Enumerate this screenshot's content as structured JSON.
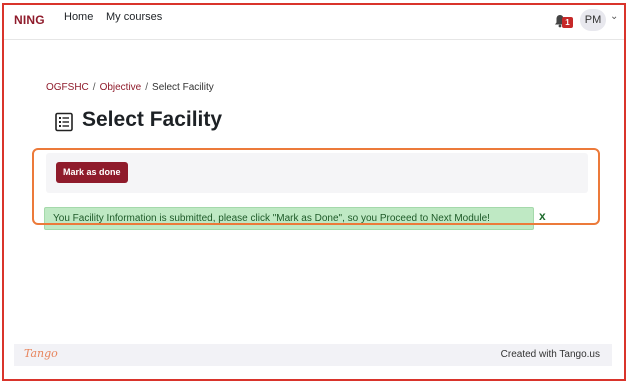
{
  "header": {
    "brand": "NING",
    "nav": [
      "Home",
      "My courses"
    ],
    "notification_count": "1",
    "user_initials": "PM"
  },
  "breadcrumb": {
    "items": [
      "OGFSHC",
      "Objective"
    ],
    "current": "Select Facility"
  },
  "page": {
    "title": "Select Facility",
    "mark_done_label": "Mark as done",
    "notice_text": "You Facility Information is submitted, please click \"Mark as Done\", so you Proceed to Next Module!",
    "close_label": "x"
  },
  "footer": {
    "logo": "Tango",
    "credit": "Created with Tango.us"
  },
  "colors": {
    "accent": "#8f1b2b",
    "highlight": "#ec7a3a",
    "notice_bg": "#bfe9c4",
    "frame_border": "#d9342b"
  },
  "icons": [
    "bell-icon",
    "chevron-down-icon",
    "page-list-icon",
    "close-icon"
  ]
}
